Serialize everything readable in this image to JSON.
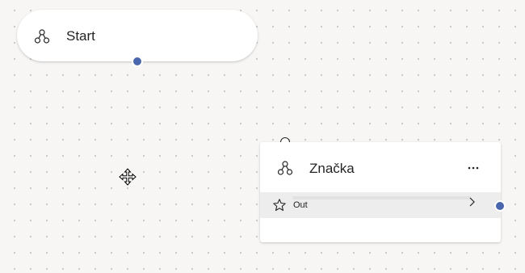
{
  "canvas": {
    "background": "#f7f6f5",
    "dot_color": "#c9c7c5"
  },
  "start_node": {
    "title": "Start",
    "icon": "node-tree-icon",
    "port_color": "#4a67ad"
  },
  "tag_node": {
    "title": "Značka",
    "icon": "node-tree-icon",
    "more_label": "···",
    "branch": {
      "label": "Out",
      "icon": "star-icon",
      "chevron": "chevron-right-icon"
    },
    "port_color": "#4a67ad"
  },
  "cursor": {
    "icon": "move-cursor-icon"
  }
}
